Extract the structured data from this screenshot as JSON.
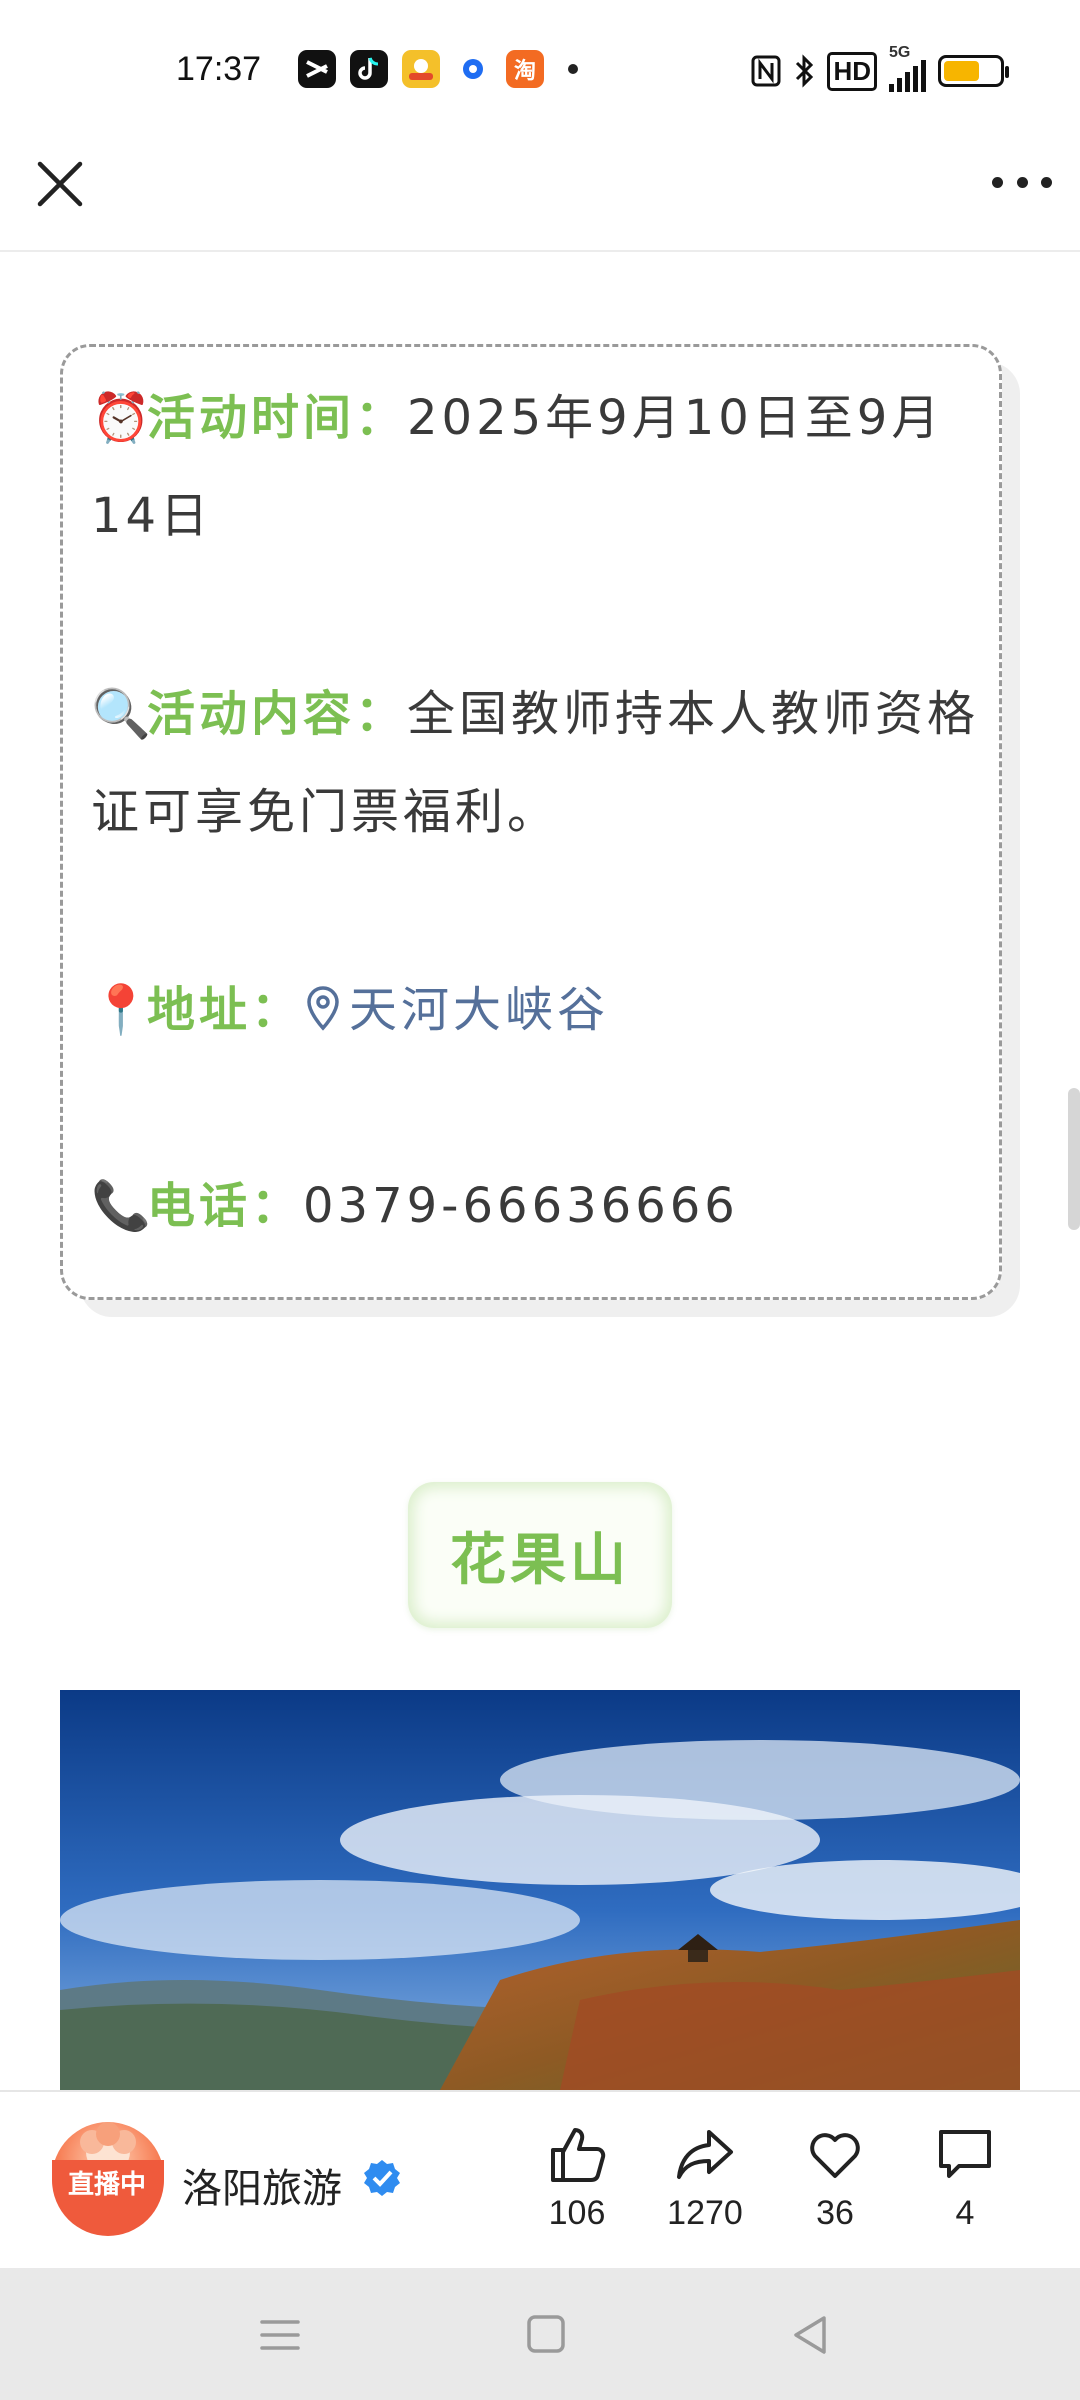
{
  "status_bar": {
    "time": "17:37",
    "notification_icons": [
      "capcut-icon",
      "tiktok-icon",
      "game-app-icon",
      "blue-dot-app-icon",
      "taobao-icon"
    ],
    "taobao_char": "淘",
    "network": "5G",
    "hd": "HD",
    "battery_level": 0.65
  },
  "nav": {
    "close_icon": "close-icon",
    "more_icon": "more-icon"
  },
  "info_card": {
    "time_label": "活动时间：",
    "time_value": "2025年9月10日至9月14日",
    "content_label": "活动内容：",
    "content_value": "全国教师持本人教师资格证可享免门票福利。",
    "address_label": "地址：",
    "address_value": "天河大峡谷",
    "phone_label": "电话：",
    "phone_value": "0379-66636666",
    "emojis": {
      "time": "⏰",
      "content": "🔍",
      "address": "📍",
      "phone": "📞"
    }
  },
  "section": {
    "title": "花果山"
  },
  "bottom_bar": {
    "live_badge": "直播中",
    "author": "洛阳旅游",
    "likes": "106",
    "shares": "1270",
    "favorites": "36",
    "comments": "4"
  },
  "colors": {
    "accent_green": "#7cbf52",
    "link_blue": "#55709a",
    "verified_blue": "#2f8cf0",
    "live_red": "#ef5a3c"
  }
}
